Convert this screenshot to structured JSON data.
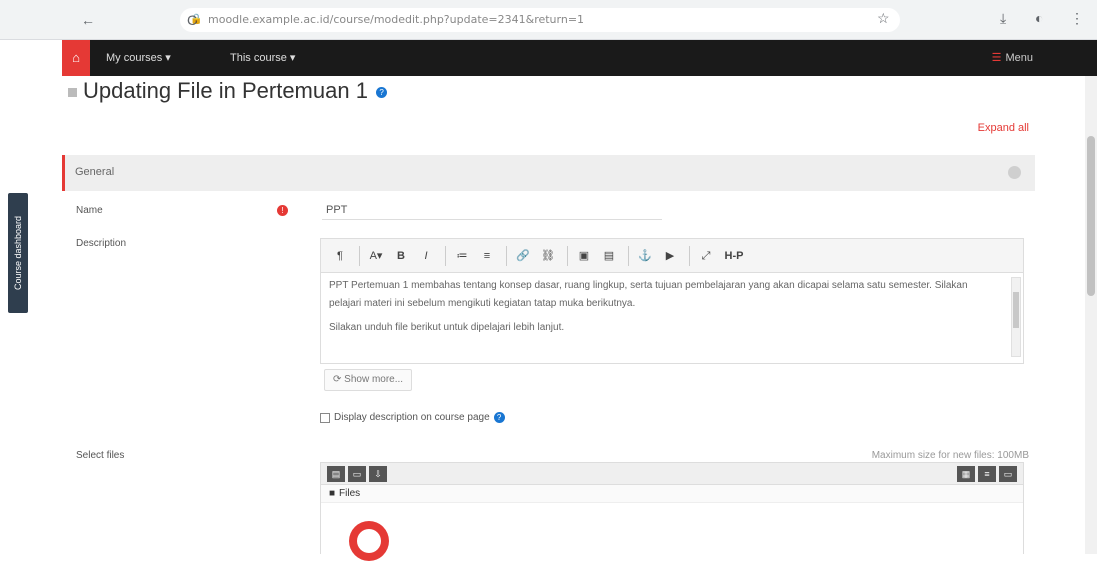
{
  "browser": {
    "back_glyph": "←",
    "reload_glyph": "C",
    "url": "moodle.example.ac.id/course/modedit.php?update=2341&return=1",
    "extensions": [
      "☆",
      "⤓",
      "◐",
      "⋮"
    ]
  },
  "navbar": {
    "brand_glyph": "⌂",
    "my_courses": "My courses ▾",
    "this_course": "This course ▾",
    "menu_label": "Menu"
  },
  "drawer": {
    "label": "Course dashboard"
  },
  "page": {
    "title": "Updating File in Pertemuan 1",
    "expand_all": "Expand all"
  },
  "general": {
    "section_title": "General",
    "name_label": "Name",
    "name_value": "PPT",
    "description_label": "Description",
    "description_paragraphs": [
      "PPT Pertemuan 1 membahas tentang konsep dasar, ruang lingkup, serta tujuan pembelajaran yang akan dicapai selama satu semester. Silakan pelajari materi ini sebelum mengikuti kegiatan tatap muka berikutnya.",
      "Silakan unduh file berikut untuk dipelajari lebih lanjut."
    ],
    "show_more": "Show more...",
    "display_description": "Display description on course page"
  },
  "select_files": {
    "label": "Select files",
    "size_note": "Maximum size for new files: 100MB",
    "path": "Files",
    "toolbar_buttons": [
      "▤",
      "▭",
      "⇩"
    ],
    "view_buttons": [
      "▦",
      "≡",
      "▭"
    ]
  },
  "toolbar": {
    "buttons": [
      "¶",
      "A▾",
      "B",
      "I",
      "≔",
      "≡",
      "🔗",
      "⛓",
      "▣",
      "▤",
      "⚓",
      "▶",
      "⤢",
      "H-P"
    ]
  },
  "colors": {
    "accent": "#e53935",
    "navbar": "#1a1a1a",
    "drawer": "#2f3e4e",
    "link": "#1976d2"
  }
}
